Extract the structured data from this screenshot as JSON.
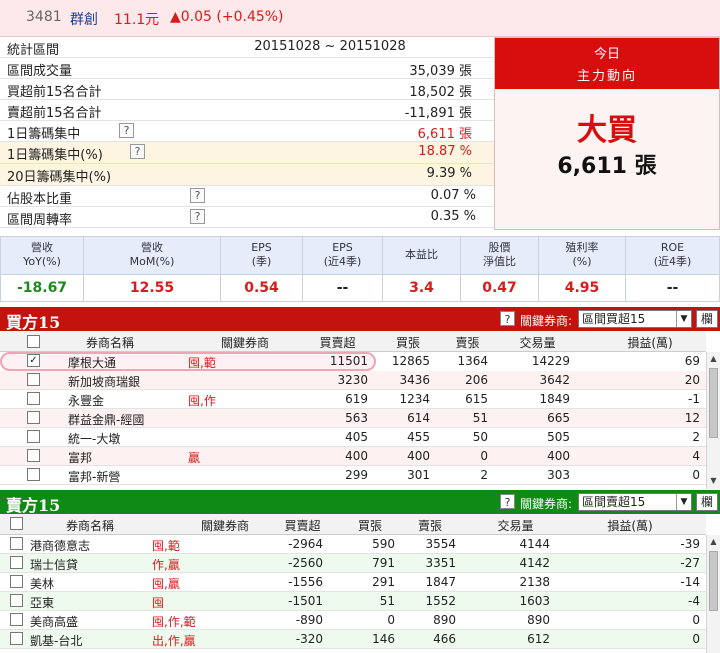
{
  "header": {
    "code": "3481",
    "name": "群創",
    "price": "11.1元",
    "change": "▲0.05 (+0.45%)",
    "up_color": "#d81c1c"
  },
  "stats": {
    "period_label": "統計區間",
    "period_value": "20151028 ~ 20151028",
    "rows": [
      {
        "label": "區間成交量",
        "value": "35,039 張"
      },
      {
        "label": "買超前15名合計",
        "value": "18,502 張"
      },
      {
        "label": "賣超前15名合計",
        "value": "-11,891 張"
      },
      {
        "label": "1日籌碼集中",
        "value": "6,611 張",
        "help": "?"
      },
      {
        "label": "1日籌碼集中(%)",
        "value": "18.87 %",
        "help": "?"
      },
      {
        "label": "20日籌碼集中(%)",
        "value": "9.39 %"
      },
      {
        "label": "佔股本比重",
        "value": "0.07 %",
        "help": "?"
      },
      {
        "label": "區間周轉率",
        "value": "0.35 %",
        "help": "?"
      }
    ]
  },
  "direction": {
    "today": "今日",
    "title": "主力動向",
    "signal": "大買",
    "amount": "6,611 張",
    "accent": "#d80d0d"
  },
  "metrics": [
    {
      "h1": "營收",
      "h2": "YoY(%)",
      "value": "-18.67",
      "color": "#1e8a1e"
    },
    {
      "h1": "營收",
      "h2": "MoM(%)",
      "value": "12.55",
      "color": "#d81c1c"
    },
    {
      "h1": "EPS",
      "h2": "(季)",
      "value": "0.54",
      "color": "#d81c1c"
    },
    {
      "h1": "EPS",
      "h2": "(近4季)",
      "value": "--",
      "color": "#222222"
    },
    {
      "h1": "本益比",
      "h2": "",
      "value": "3.4",
      "color": "#d81c1c"
    },
    {
      "h1": "股價",
      "h2": "淨值比",
      "value": "0.47",
      "color": "#d81c1c"
    },
    {
      "h1": "殖利率",
      "h2": "(%)",
      "value": "4.95",
      "color": "#d81c1c"
    },
    {
      "h1": "ROE",
      "h2": "(近4季)",
      "value": "--",
      "color": "#222222"
    }
  ],
  "buy": {
    "title": "買方15",
    "help": "?",
    "key_label": "關鍵券商:",
    "select_value": "區間買超15",
    "grid_btn": "欄",
    "color": "#c4120d",
    "columns": [
      "券商名稱",
      "關鍵券商",
      "買賣超",
      "買張",
      "賣張",
      "交易量",
      "損益(萬)"
    ],
    "rows": [
      {
        "checked": "✓",
        "broker": "摩根大通",
        "key": "囤,範",
        "net": "11501",
        "buy": "12865",
        "sell": "1364",
        "vol": "14229",
        "pl": "69"
      },
      {
        "checked": "",
        "broker": "新加坡商瑞銀",
        "key": "",
        "net": "3230",
        "buy": "3436",
        "sell": "206",
        "vol": "3642",
        "pl": "20"
      },
      {
        "checked": "",
        "broker": "永豐金",
        "key": "囤,作",
        "net": "619",
        "buy": "1234",
        "sell": "615",
        "vol": "1849",
        "pl": "-1"
      },
      {
        "checked": "",
        "broker": "群益金鼎-經國",
        "key": "",
        "net": "563",
        "buy": "614",
        "sell": "51",
        "vol": "665",
        "pl": "12"
      },
      {
        "checked": "",
        "broker": "統一-大墩",
        "key": "",
        "net": "405",
        "buy": "455",
        "sell": "50",
        "vol": "505",
        "pl": "2"
      },
      {
        "checked": "",
        "broker": "富邦",
        "key": "贏",
        "net": "400",
        "buy": "400",
        "sell": "0",
        "vol": "400",
        "pl": "4"
      },
      {
        "checked": "",
        "broker": "富邦-新營",
        "key": "",
        "net": "299",
        "buy": "301",
        "sell": "2",
        "vol": "303",
        "pl": "0"
      }
    ]
  },
  "sell": {
    "title": "賣方15",
    "help": "?",
    "key_label": "關鍵券商:",
    "select_value": "區間賣超15",
    "grid_btn": "欄",
    "color": "#0f8a14",
    "columns": [
      "券商名稱",
      "關鍵券商",
      "買賣超",
      "買張",
      "賣張",
      "交易量",
      "損益(萬)"
    ],
    "rows": [
      {
        "broker": "港商德意志",
        "key": "囤,範",
        "net": "-2964",
        "buy": "590",
        "sell": "3554",
        "vol": "4144",
        "pl": "-39"
      },
      {
        "broker": "瑞士信貸",
        "key": "作,贏",
        "net": "-2560",
        "buy": "791",
        "sell": "3351",
        "vol": "4142",
        "pl": "-27"
      },
      {
        "broker": "美林",
        "key": "囤,贏",
        "net": "-1556",
        "buy": "291",
        "sell": "1847",
        "vol": "2138",
        "pl": "-14"
      },
      {
        "broker": "亞東",
        "key": "囤",
        "net": "-1501",
        "buy": "51",
        "sell": "1552",
        "vol": "1603",
        "pl": "-4"
      },
      {
        "broker": "美商高盛",
        "key": "囤,作,範",
        "net": "-890",
        "buy": "0",
        "sell": "890",
        "vol": "890",
        "pl": "0"
      },
      {
        "broker": "凱基-台北",
        "key": "出,作,贏",
        "net": "-320",
        "buy": "146",
        "sell": "466",
        "vol": "612",
        "pl": "0"
      }
    ]
  }
}
